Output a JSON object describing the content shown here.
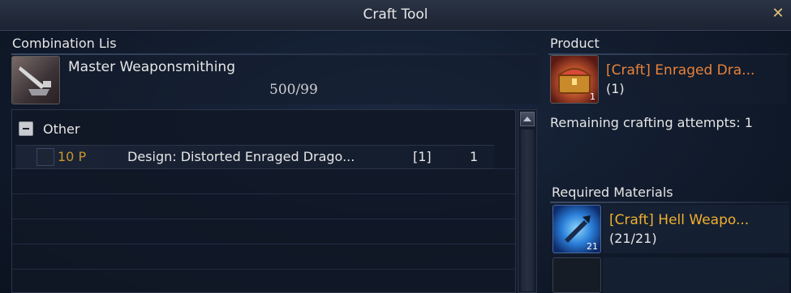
{
  "window": {
    "title": "Craft Tool",
    "close_icon": "close-icon"
  },
  "combination": {
    "label": "Combination Lis",
    "skill": {
      "name": "Master Weaponsmithing",
      "progress": "500/99",
      "icon": "weaponsmith-anvil-icon"
    }
  },
  "list": {
    "category": {
      "label": "Other",
      "toggle_icon": "collapse-minus-icon"
    },
    "items": [
      {
        "cost": "10 P",
        "name": "Design: Distorted Enraged Drago...",
        "qty": "[1]",
        "count": "1"
      }
    ]
  },
  "product": {
    "label": "Product",
    "name": "[Craft] Enraged Dra...",
    "qty": "(1)",
    "badge": "1",
    "icon": "treasure-chest-icon",
    "remaining_text": "Remaining crafting attempts: 1"
  },
  "materials": {
    "label": "Required Materials",
    "items": [
      {
        "name": "[Craft] Hell Weapo...",
        "qty": "(21/21)",
        "badge": "21",
        "icon": "blue-weapon-orb-icon"
      }
    ]
  },
  "colors": {
    "product_name": "#e8823a",
    "material_name": "#f0b030",
    "cost": "#c8962a"
  }
}
